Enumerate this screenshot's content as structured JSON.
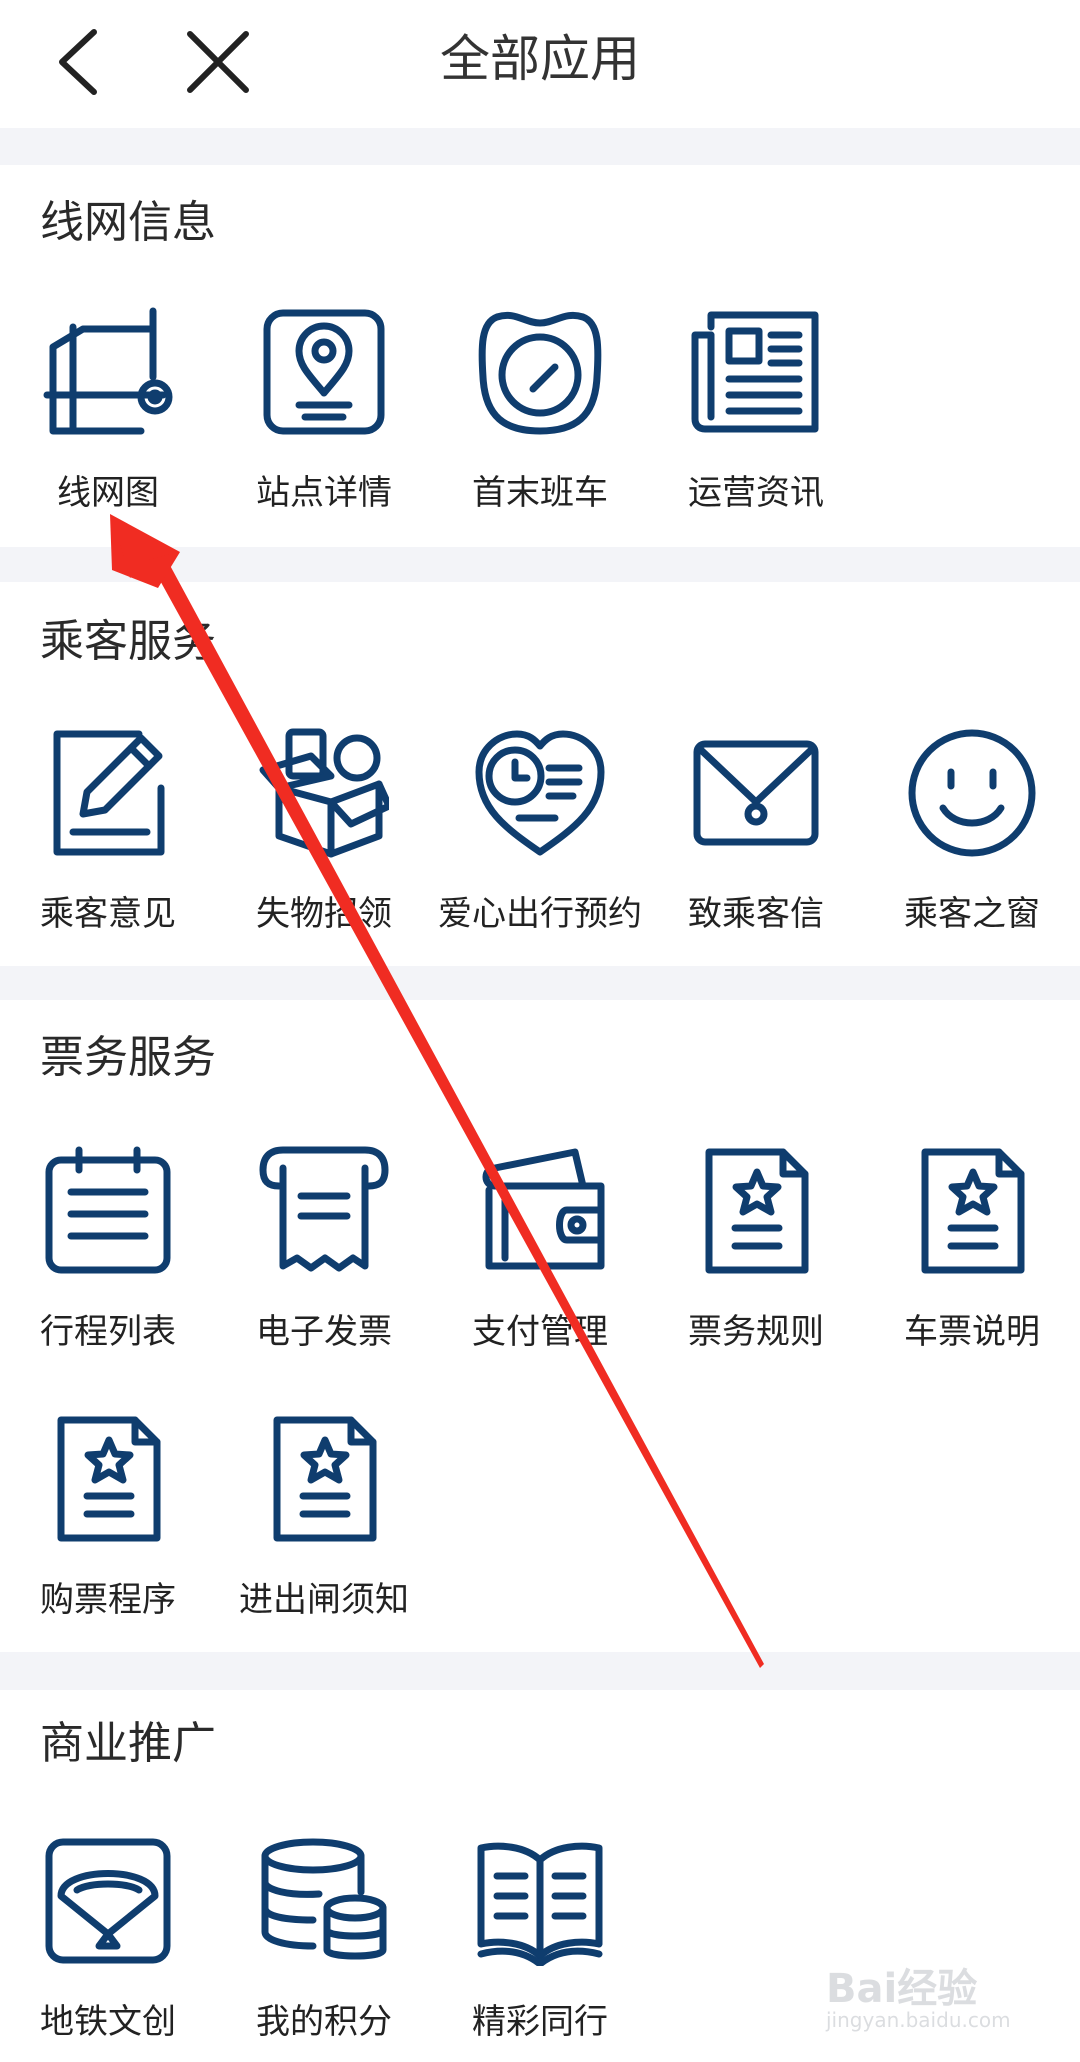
{
  "header": {
    "title": "全部应用"
  },
  "sections": [
    {
      "title": "线网信息",
      "apps": [
        {
          "label": "线网图",
          "icon": "network-map-icon"
        },
        {
          "label": "站点详情",
          "icon": "location-pin-icon"
        },
        {
          "label": "首末班车",
          "icon": "clock-icon"
        },
        {
          "label": "运营资讯",
          "icon": "newspaper-icon"
        }
      ]
    },
    {
      "title": "乘客服务",
      "apps": [
        {
          "label": "乘客意见",
          "icon": "edit-note-icon"
        },
        {
          "label": "失物招领",
          "icon": "open-box-icon"
        },
        {
          "label": "爱心出行预约",
          "icon": "heart-clock-icon"
        },
        {
          "label": "致乘客信",
          "icon": "envelope-icon"
        },
        {
          "label": "乘客之窗",
          "icon": "smiley-icon"
        }
      ]
    },
    {
      "title": "票务服务",
      "apps": [
        {
          "label": "行程列表",
          "icon": "calendar-list-icon"
        },
        {
          "label": "电子发票",
          "icon": "receipt-icon"
        },
        {
          "label": "支付管理",
          "icon": "wallet-icon"
        },
        {
          "label": "票务规则",
          "icon": "star-document-icon"
        },
        {
          "label": "车票说明",
          "icon": "star-document-icon"
        },
        {
          "label": "购票程序",
          "icon": "star-document-icon"
        },
        {
          "label": "进出闸须知",
          "icon": "star-document-icon"
        }
      ]
    },
    {
      "title": "商业推广",
      "apps": [
        {
          "label": "地铁文创",
          "icon": "fan-icon"
        },
        {
          "label": "我的积分",
          "icon": "coin-stack-icon"
        },
        {
          "label": "精彩同行",
          "icon": "open-book-icon"
        }
      ]
    }
  ],
  "watermark": {
    "text": "Bai经验",
    "sub": "jingyan.baidu.com"
  },
  "colors": {
    "icon": "#0f3d6e",
    "arrow": "#f02c22",
    "background": "#f3f4f8"
  }
}
